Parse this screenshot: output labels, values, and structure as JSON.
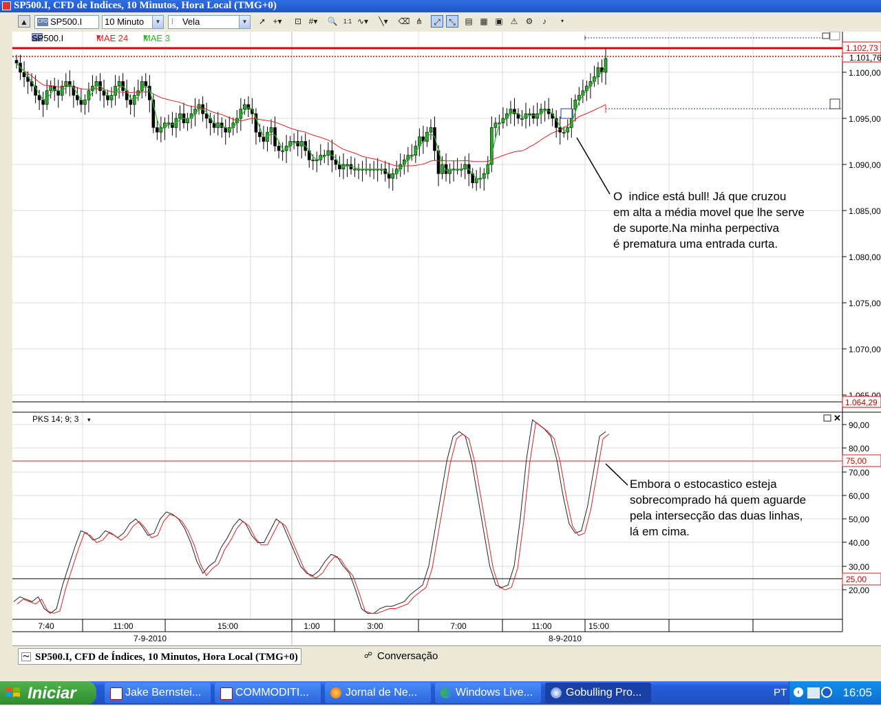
{
  "window": {
    "title": "SP500.I, CFD de Indices, 10 Minutos, Hora Local (TMG+0)"
  },
  "toolbar": {
    "symbol": "SP500.I",
    "interval": "10 Minuto",
    "chart_type": "Vela",
    "tools": [
      "cursor-icon",
      "crosshair-icon",
      "data-window-icon",
      "grid-icon",
      "zoom-icon",
      "scale-icon",
      "wave-icon",
      "trendline-icon",
      "eraser-icon",
      "magnet-icon",
      "auto-scroll-icon",
      "template-icon",
      "print-icon",
      "save-icon",
      "alert-icon",
      "properties-icon",
      "more-icon"
    ]
  },
  "legend": {
    "symbol": "SP500.I",
    "ma1": "MAE 24",
    "ma2": "MAE 3",
    "ma1_color": "#dd2222",
    "ma2_color": "#22bb22"
  },
  "price_axis": {
    "labels": [
      "1.100,00",
      "1.095,00",
      "1.090,00",
      "1.085,00",
      "1.080,00",
      "1.075,00",
      "1.070,00",
      "1.065,00"
    ],
    "current_price": "1.102,73",
    "second_price": "1.101,76",
    "low_marker": "1.064,29"
  },
  "indicator": {
    "label": "PKS 14; 9; 3",
    "axis_labels": [
      "90,00",
      "80,00",
      "70,00",
      "60,00",
      "50,00",
      "40,00",
      "30,00",
      "20,00"
    ],
    "upper_level": "75,00",
    "lower_level": "25,00"
  },
  "time_axis": {
    "ticks": [
      "7:40",
      "11:00",
      "15:00",
      "1:00",
      "3:00",
      "7:00",
      "11:00",
      "15:00"
    ],
    "dates": [
      "7-9-2010",
      "8-9-2010"
    ]
  },
  "annotations": {
    "note1": "O  indice está bull! Já que cruzou\nem alta a média movel que lhe serve\nde suporte.Na minha perpectiva\né prematura uma entrada curta.",
    "note2": "Embora o estocastico esteja\nsobrecomprado há quem aguarde\npela intersecção das duas linhas,\nlá em cima."
  },
  "tabs": [
    {
      "label": "SP500.I, CFD de Índices, 10 Minutos, Hora Local (TMG+0)"
    },
    {
      "label": "Conversação"
    }
  ],
  "taskbar": {
    "start": "Iniciar",
    "tasks": [
      "Jake Bernstei...",
      "COMMODITI...",
      "Jornal de Ne...",
      "Windows Live...",
      "Gobulling Pro..."
    ],
    "language": "PT",
    "clock": "16:05"
  },
  "chart_data": [
    {
      "type": "candlestick",
      "title": "SP500.I",
      "series": [
        {
          "name": "MAE 24"
        },
        {
          "name": "MAE 3"
        }
      ],
      "ylim": [
        1063,
        1104
      ],
      "current_price": 1102.73,
      "levels": [
        1102.73,
        1101.76,
        1064.29
      ],
      "closes": [
        1101,
        1100,
        1099.5,
        1099,
        1098.5,
        1097.5,
        1097,
        1096.5,
        1098,
        1098.5,
        1098,
        1097.5,
        1098.5,
        1099,
        1098.5,
        1097.5,
        1097,
        1096.5,
        1097,
        1098,
        1098.5,
        1099,
        1098,
        1097.5,
        1097,
        1097.5,
        1098.5,
        1099,
        1098,
        1097,
        1096.5,
        1097.5,
        1098,
        1099,
        1098.5,
        1097,
        1094,
        1093.5,
        1094,
        1094.5,
        1094.5,
        1094,
        1095,
        1095.5,
        1094.5,
        1095,
        1095.5,
        1096,
        1096.5,
        1095.5,
        1095,
        1094.5,
        1094,
        1094.5,
        1094,
        1093.5,
        1094,
        1094.5,
        1095,
        1096,
        1096.5,
        1096,
        1095.5,
        1093.5,
        1093,
        1092.5,
        1093.5,
        1094,
        1092,
        1091.5,
        1091.5,
        1092,
        1092.5,
        1092.5,
        1092,
        1092.5,
        1091.5,
        1090.5,
        1090.5,
        1090.5,
        1091,
        1091,
        1091.5,
        1090.5,
        1090,
        1089.5,
        1090,
        1090,
        1089.5,
        1089.5,
        1089.5,
        1089.5,
        1089.5,
        1089.5,
        1089.5,
        1089.5,
        1089.5,
        1089,
        1088.5,
        1089,
        1089.5,
        1090,
        1090.5,
        1091,
        1091,
        1092,
        1093,
        1092.5,
        1093.5,
        1094,
        1091.5,
        1089,
        1090,
        1089,
        1089.5,
        1089.5,
        1089.5,
        1089.5,
        1090,
        1089,
        1088,
        1088.5,
        1088.5,
        1089,
        1090,
        1094,
        1094.5,
        1094.5,
        1095,
        1095.5,
        1096,
        1095.5,
        1095,
        1095,
        1095.5,
        1095.5,
        1095,
        1095.5,
        1096,
        1096,
        1095.5,
        1095,
        1094,
        1093.5,
        1093.5,
        1094,
        1096,
        1097,
        1097.5,
        1098,
        1098.5,
        1099,
        1099.5,
        1100.5,
        1100,
        1101.5
      ]
    },
    {
      "type": "line",
      "title": "PKS 14; 9; 3",
      "series": [
        {
          "name": "PKS 14; 9; 3"
        }
      ],
      "ylim": [
        10,
        95
      ],
      "levels": [
        75,
        25
      ],
      "values": [
        15,
        17,
        16,
        15,
        17,
        12,
        10,
        12,
        22,
        30,
        38,
        45,
        44,
        41,
        42,
        45,
        44,
        42,
        44,
        48,
        50,
        47,
        43,
        44,
        50,
        53,
        52,
        50,
        46,
        40,
        32,
        27,
        30,
        32,
        38,
        42,
        47,
        50,
        48,
        43,
        40,
        40,
        45,
        50,
        48,
        42,
        36,
        30,
        27,
        26,
        28,
        32,
        35,
        34,
        30,
        27,
        20,
        12,
        10,
        10,
        12,
        13,
        13,
        14,
        15,
        18,
        20,
        22,
        30,
        45,
        60,
        75,
        85,
        87,
        85,
        75,
        60,
        45,
        30,
        22,
        21,
        22,
        30,
        50,
        75,
        92,
        90,
        88,
        85,
        75,
        60,
        48,
        44,
        45,
        55,
        70,
        85,
        87
      ]
    }
  ]
}
